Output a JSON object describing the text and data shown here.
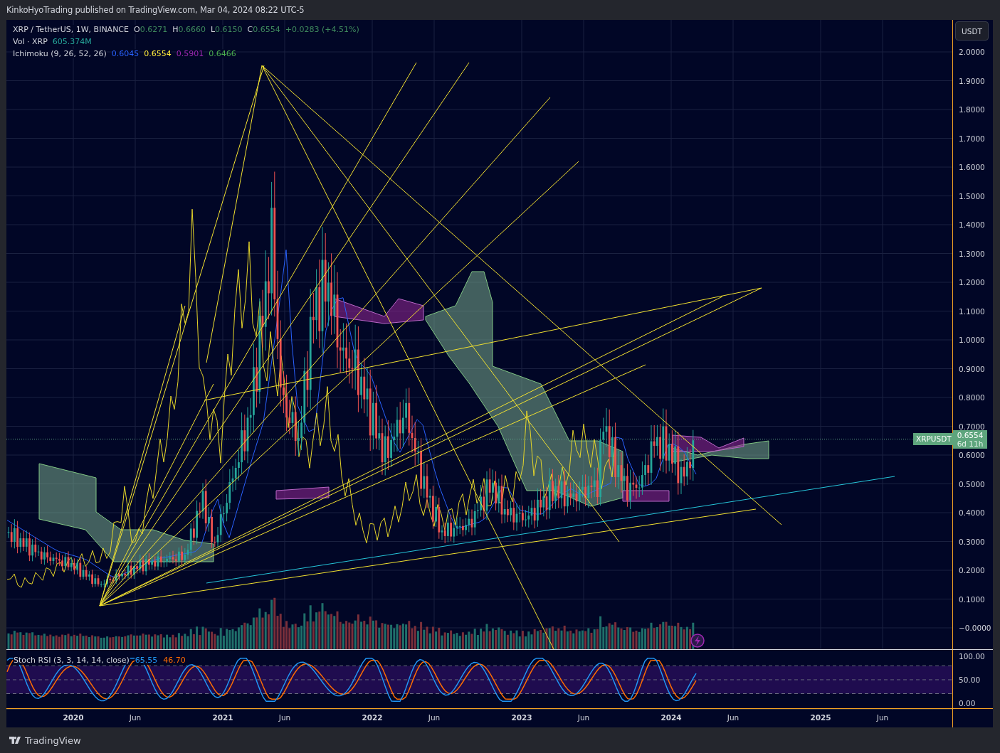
{
  "header": {
    "publish_note": "KinkoHyoTrading published on TradingView.com, Mar 04, 2024 08:22 UTC-5"
  },
  "legend": {
    "symbol": "XRP / TetherUS, 1W, BINANCE",
    "ohlc": [
      {
        "label": "O",
        "value": "0.6271"
      },
      {
        "label": "H",
        "value": "0.6660"
      },
      {
        "label": "L",
        "value": "0.6150"
      },
      {
        "label": "C",
        "value": "0.6554"
      }
    ],
    "change": "+0.0283 (+4.51%)",
    "volume": {
      "label": "Vol · XRP",
      "value": "605.374M"
    },
    "ichimoku": {
      "label": "Ichimoku (9, 26, 52, 26)",
      "values": [
        {
          "value": "0.6045",
          "color": "#2962ff"
        },
        {
          "value": "0.6554",
          "color": "#ffeb3b"
        },
        {
          "value": "0.5901",
          "color": "#9c27b0"
        },
        {
          "value": "0.6466",
          "color": "#4caf50"
        }
      ]
    }
  },
  "price_axis": {
    "currency": "USDT",
    "ticks": [
      "2.0000",
      "1.9000",
      "1.8000",
      "1.7000",
      "1.6000",
      "1.5000",
      "1.4000",
      "1.3000",
      "1.2000",
      "1.1000",
      "1.0000",
      "0.9000",
      "0.8000",
      "0.7000",
      "0.6000",
      "0.5000",
      "0.4000",
      "0.3000",
      "0.2000",
      "0.1000",
      "−0.0000"
    ]
  },
  "price_tag": {
    "symbol": "XRPUSDT",
    "price": "0.6554",
    "countdown": "6d 11h"
  },
  "stoch_rsi": {
    "label": "Stoch RSI (3, 3, 14, 14, close)",
    "values": [
      {
        "value": "65.55",
        "color": "#2196f3"
      },
      {
        "value": "46.70",
        "color": "#ff6d00"
      }
    ],
    "ticks": [
      "100.00",
      "50.00",
      "0.00"
    ]
  },
  "time_axis": {
    "ticks": [
      {
        "label": "2020",
        "kind": "year"
      },
      {
        "label": "Jun",
        "kind": "month"
      },
      {
        "label": "2021",
        "kind": "year"
      },
      {
        "label": "Jun",
        "kind": "month"
      },
      {
        "label": "2022",
        "kind": "year"
      },
      {
        "label": "Jun",
        "kind": "month"
      },
      {
        "label": "2023",
        "kind": "year"
      },
      {
        "label": "Jun",
        "kind": "month"
      },
      {
        "label": "2024",
        "kind": "year"
      },
      {
        "label": "Jun",
        "kind": "month"
      },
      {
        "label": "2025",
        "kind": "year"
      },
      {
        "label": "Jun",
        "kind": "month"
      }
    ]
  },
  "footer": {
    "brand": "TradingView"
  }
}
